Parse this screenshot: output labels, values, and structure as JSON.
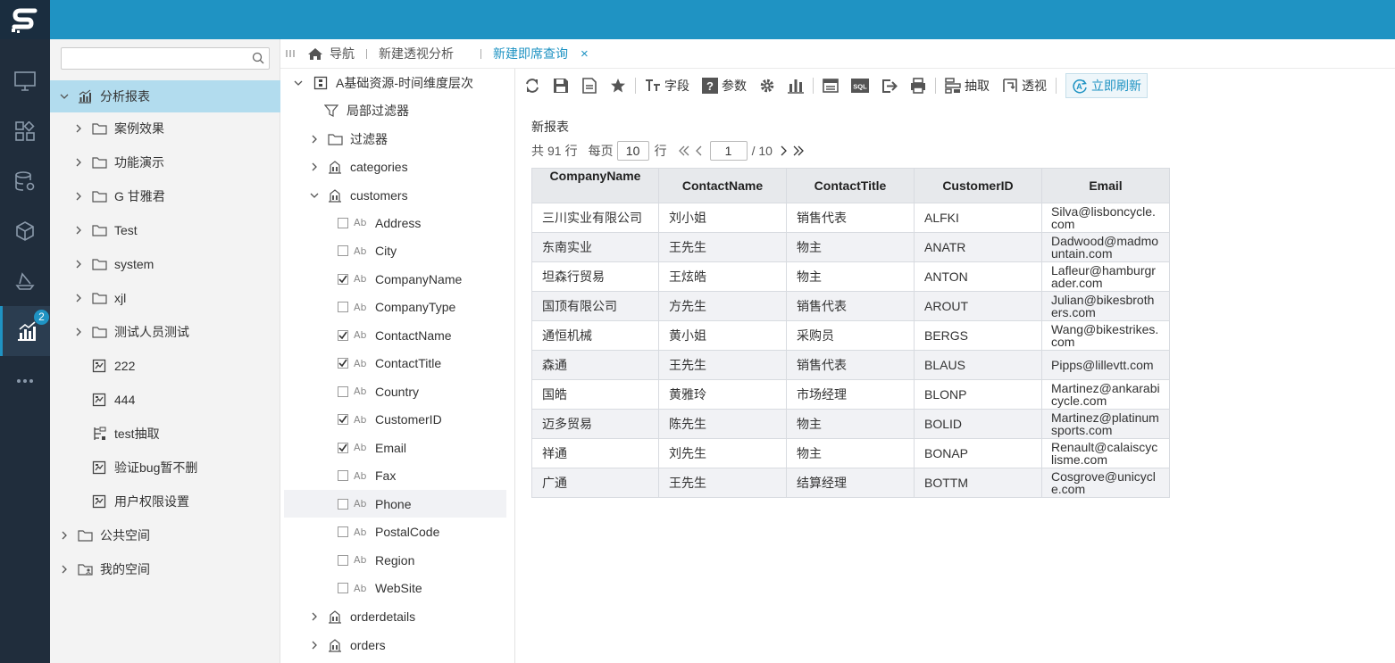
{
  "app": {
    "logo_text": "S"
  },
  "rail": {
    "items": [
      {
        "name": "monitor"
      },
      {
        "name": "apps"
      },
      {
        "name": "database-gear"
      },
      {
        "name": "cube"
      },
      {
        "name": "ship"
      },
      {
        "name": "chart-active",
        "badge": "2"
      },
      {
        "name": "more"
      }
    ]
  },
  "nav": {
    "search_placeholder": "",
    "items": [
      {
        "label": "分析报表",
        "type": "report-root",
        "expanded": true
      },
      {
        "label": "案例效果",
        "type": "folder"
      },
      {
        "label": "功能演示",
        "type": "folder"
      },
      {
        "label": "G 甘雅君",
        "type": "folder"
      },
      {
        "label": "Test",
        "type": "folder"
      },
      {
        "label": "system",
        "type": "folder"
      },
      {
        "label": "xjl",
        "type": "folder"
      },
      {
        "label": "测试人员测试",
        "type": "folder"
      },
      {
        "label": "222",
        "type": "report"
      },
      {
        "label": "444",
        "type": "report"
      },
      {
        "label": "test抽取",
        "type": "extract"
      },
      {
        "label": "验证bug暂不删",
        "type": "report"
      },
      {
        "label": "用户权限设置",
        "type": "report"
      },
      {
        "label": "公共空间",
        "type": "folder"
      },
      {
        "label": "我的空间",
        "type": "folder-user"
      }
    ]
  },
  "tabs": {
    "items": [
      {
        "label": "导航"
      },
      {
        "label": "新建透视分析"
      },
      {
        "label": "新建即席查询",
        "active": true,
        "close": "×"
      }
    ]
  },
  "fields": {
    "source": "A基础资源-时间维度层次",
    "local_filter": "局部过滤器",
    "filter": "过滤器",
    "tables_before": [
      {
        "label": "categories"
      }
    ],
    "customers": "customers",
    "columns": [
      {
        "label": "Address",
        "checked": false
      },
      {
        "label": "City",
        "checked": false
      },
      {
        "label": "CompanyName",
        "checked": true
      },
      {
        "label": "CompanyType",
        "checked": false
      },
      {
        "label": "ContactName",
        "checked": true
      },
      {
        "label": "ContactTitle",
        "checked": true
      },
      {
        "label": "Country",
        "checked": false
      },
      {
        "label": "CustomerID",
        "checked": true
      },
      {
        "label": "Email",
        "checked": true
      },
      {
        "label": "Fax",
        "checked": false
      },
      {
        "label": "Phone",
        "checked": false
      },
      {
        "label": "PostalCode",
        "checked": false
      },
      {
        "label": "Region",
        "checked": false
      },
      {
        "label": "WebSite",
        "checked": false
      }
    ],
    "tables_after": [
      {
        "label": "orderdetails"
      },
      {
        "label": "orders"
      }
    ],
    "type_glyph": "Ab"
  },
  "toolbar": {
    "fields_label": "字段",
    "params_label": "参数",
    "extract_label": "抽取",
    "pivot_label": "透视",
    "refresh_label": "立即刷新"
  },
  "report": {
    "title": "新报表",
    "pager": {
      "total_prefix": "共",
      "total": "91",
      "total_suffix": "行",
      "per_page_label": "每页",
      "per_page": "10",
      "per_page_suffix": "行",
      "page": "1",
      "pages_text": "/ 10"
    },
    "columns": [
      "CompanyName",
      "ContactName",
      "ContactTitle",
      "CustomerID",
      "Email"
    ],
    "rows": [
      [
        "三川实业有限公司",
        "刘小姐",
        "销售代表",
        "ALFKI",
        "Silva@lisboncycle.com"
      ],
      [
        "东南实业",
        "王先生",
        "物主",
        "ANATR",
        "Dadwood@madmountain.com"
      ],
      [
        "坦森行贸易",
        "王炫皓",
        "物主",
        "ANTON",
        "Lafleur@hamburgrader.com"
      ],
      [
        "国顶有限公司",
        "方先生",
        "销售代表",
        "AROUT",
        "Julian@bikesbrothers.com"
      ],
      [
        "通恒机械",
        "黄小姐",
        "采购员",
        "BERGS",
        "Wang@bikestrikes.com"
      ],
      [
        "森通",
        "王先生",
        "销售代表",
        "BLAUS",
        "Pipps@lillevtt.com"
      ],
      [
        "国皓",
        "黄雅玲",
        "市场经理",
        "BLONP",
        "Martinez@ankarabicycle.com"
      ],
      [
        "迈多贸易",
        "陈先生",
        "物主",
        "BOLID",
        "Martinez@platinumsports.com"
      ],
      [
        "祥通",
        "刘先生",
        "物主",
        "BONAP",
        "Renault@calaiscyclisme.com"
      ],
      [
        "广通",
        "王先生",
        "结算经理",
        "BOTTM",
        "Cosgrove@unicycle.com"
      ]
    ]
  },
  "colors": {
    "accent": "#1f93c3",
    "rail": "#202d3c",
    "selected": "#b2dcee"
  }
}
